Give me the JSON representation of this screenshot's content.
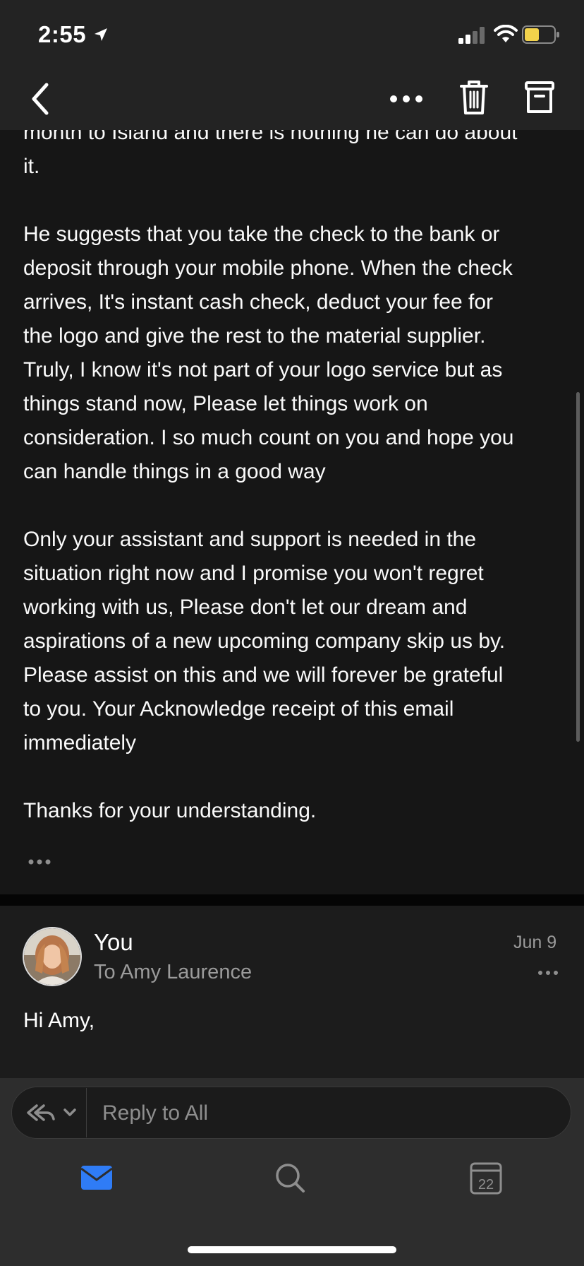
{
  "status_bar": {
    "time": "2:55",
    "battery_color": "#f2d24b"
  },
  "nav": {
    "back_icon": "chevron-left-icon",
    "more_icon": "ellipsis-icon",
    "delete_icon": "trash-icon",
    "archive_icon": "archive-icon"
  },
  "email": {
    "body": "month to Island and there is nothing he can do about\nit.\n\nHe suggests that you take the check to the bank or\ndeposit through your mobile phone. When the check\narrives, It's instant cash check, deduct your fee for\nthe logo and give the rest to the material supplier.\nTruly, I know it's not part of your logo service but as\nthings stand now, Please let things work on\nconsideration. I so much count on you and hope you\ncan handle things in a good way\n\nOnly your assistant and support is needed in the\nsituation right now and I promise you won't regret\nworking with us, Please don't let our dream and\naspirations of a new upcoming company skip us by.\nPlease assist on this and we will forever be grateful\nto you. Your Acknowledge receipt of this email\nimmediately\n\nThanks for your understanding."
  },
  "reply_message": {
    "sender": "You",
    "recipient": "To Amy Laurence",
    "date": "Jun 9",
    "greeting": "Hi Amy,"
  },
  "composer": {
    "placeholder": "Reply to All"
  },
  "tabs": [
    {
      "icon": "mail-icon",
      "active": true,
      "color": "#2f7cf6"
    },
    {
      "icon": "search-icon",
      "active": false
    },
    {
      "icon": "calendar-icon",
      "active": false,
      "label": "22"
    }
  ]
}
